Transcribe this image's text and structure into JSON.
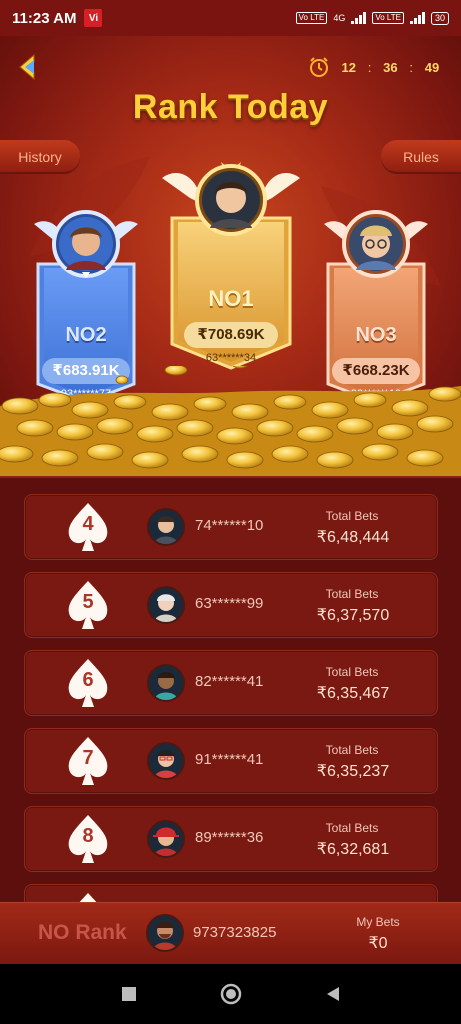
{
  "status_bar": {
    "time": "11:23 AM",
    "carrier_badge": "Vi",
    "volte1": "Vo LTE",
    "volte2": "Vo LTE",
    "network": "4G",
    "battery": "30"
  },
  "header": {
    "title": "Rank Today",
    "history_label": "History",
    "rules_label": "Rules",
    "timer": {
      "hours": "12",
      "minutes": "36",
      "seconds": "49",
      "separator": ":"
    }
  },
  "podium": [
    {
      "rank_label": "NO2",
      "amount": "₹683.91K",
      "user": "93******77",
      "theme": "blue"
    },
    {
      "rank_label": "NO1",
      "amount": "₹708.69K",
      "user": "63******34",
      "theme": "gold"
    },
    {
      "rank_label": "NO3",
      "amount": "₹668.23K",
      "user": "93******19",
      "theme": "bronze"
    }
  ],
  "list": {
    "bets_label": "Total Bets",
    "rows": [
      {
        "rank": "4",
        "user": "74******10",
        "bets": "₹6,48,444"
      },
      {
        "rank": "5",
        "user": "63******99",
        "bets": "₹6,37,570"
      },
      {
        "rank": "6",
        "user": "82******41",
        "bets": "₹6,35,467"
      },
      {
        "rank": "7",
        "user": "91******41",
        "bets": "₹6,35,237"
      },
      {
        "rank": "8",
        "user": "89******36",
        "bets": "₹6,32,681"
      }
    ]
  },
  "my_rank": {
    "rank_label": "NO Rank",
    "user": "9737323825",
    "bets_label": "My Bets",
    "bets": "₹0"
  },
  "colors": {
    "gold": "#ffcf3a",
    "background": "#5c0f0c",
    "row": "#7a1912",
    "blue_card": "#5a8ee8",
    "bronze_card": "#e39263"
  }
}
